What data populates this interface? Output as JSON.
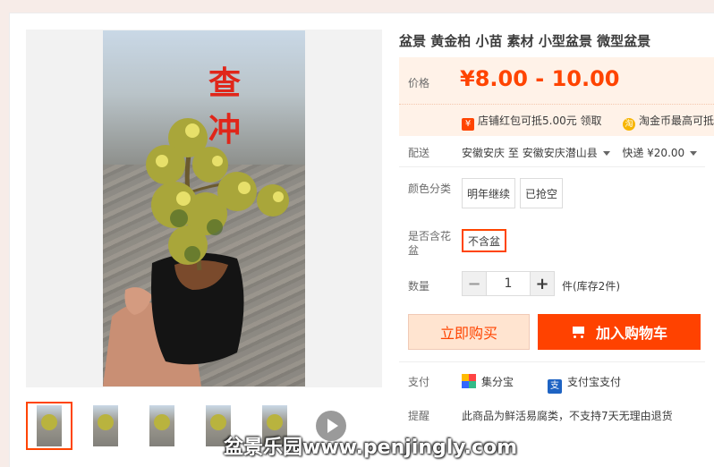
{
  "product": {
    "title": "盆景 黄金柏 小苗 素材 小型盆景 微型盆景",
    "photo_overlay_text": "查 冲"
  },
  "price": {
    "label": "价格",
    "value": "¥8.00 - 10.00",
    "promo_shop": "店铺红包可抵5.00元 领取",
    "promo_coin": "淘金币最高可抵",
    "promo_shop_icon": "yen-icon",
    "promo_coin_icon": "coin-icon"
  },
  "shipping": {
    "label": "配送",
    "from": "安徽安庆",
    "to_word": "至",
    "to": "安徽安庆潜山县",
    "method": "快递 ¥20.00"
  },
  "color_options": {
    "label": "颜色分类",
    "options": [
      "明年继续",
      "已抢空"
    ]
  },
  "pot_option": {
    "label": "是否含花盆",
    "options": [
      "不含盆"
    ],
    "selected": "不含盆"
  },
  "quantity": {
    "label": "数量",
    "minus": "−",
    "value": "1",
    "plus": "+",
    "stock": "件(库存2件)"
  },
  "actions": {
    "buy_now": "立即购买",
    "add_to_cart": "加入购物车"
  },
  "payment": {
    "label": "支付",
    "method1": "集分宝",
    "method2": "支付宝支付",
    "method2_icon_text": "支"
  },
  "reminder": {
    "label": "提醒",
    "text": "此商品为鲜活易腐类，不支持7天无理由退货"
  },
  "gallery": {
    "thumb_count": 5,
    "active_index": 0
  },
  "watermark": "盆景乐园www.penjingly.com",
  "colors": {
    "accent": "#ff4400",
    "price_bg": "#fff2e8",
    "buy_now_bg": "#ffe4d0",
    "cart_bg": "#ff4200"
  }
}
